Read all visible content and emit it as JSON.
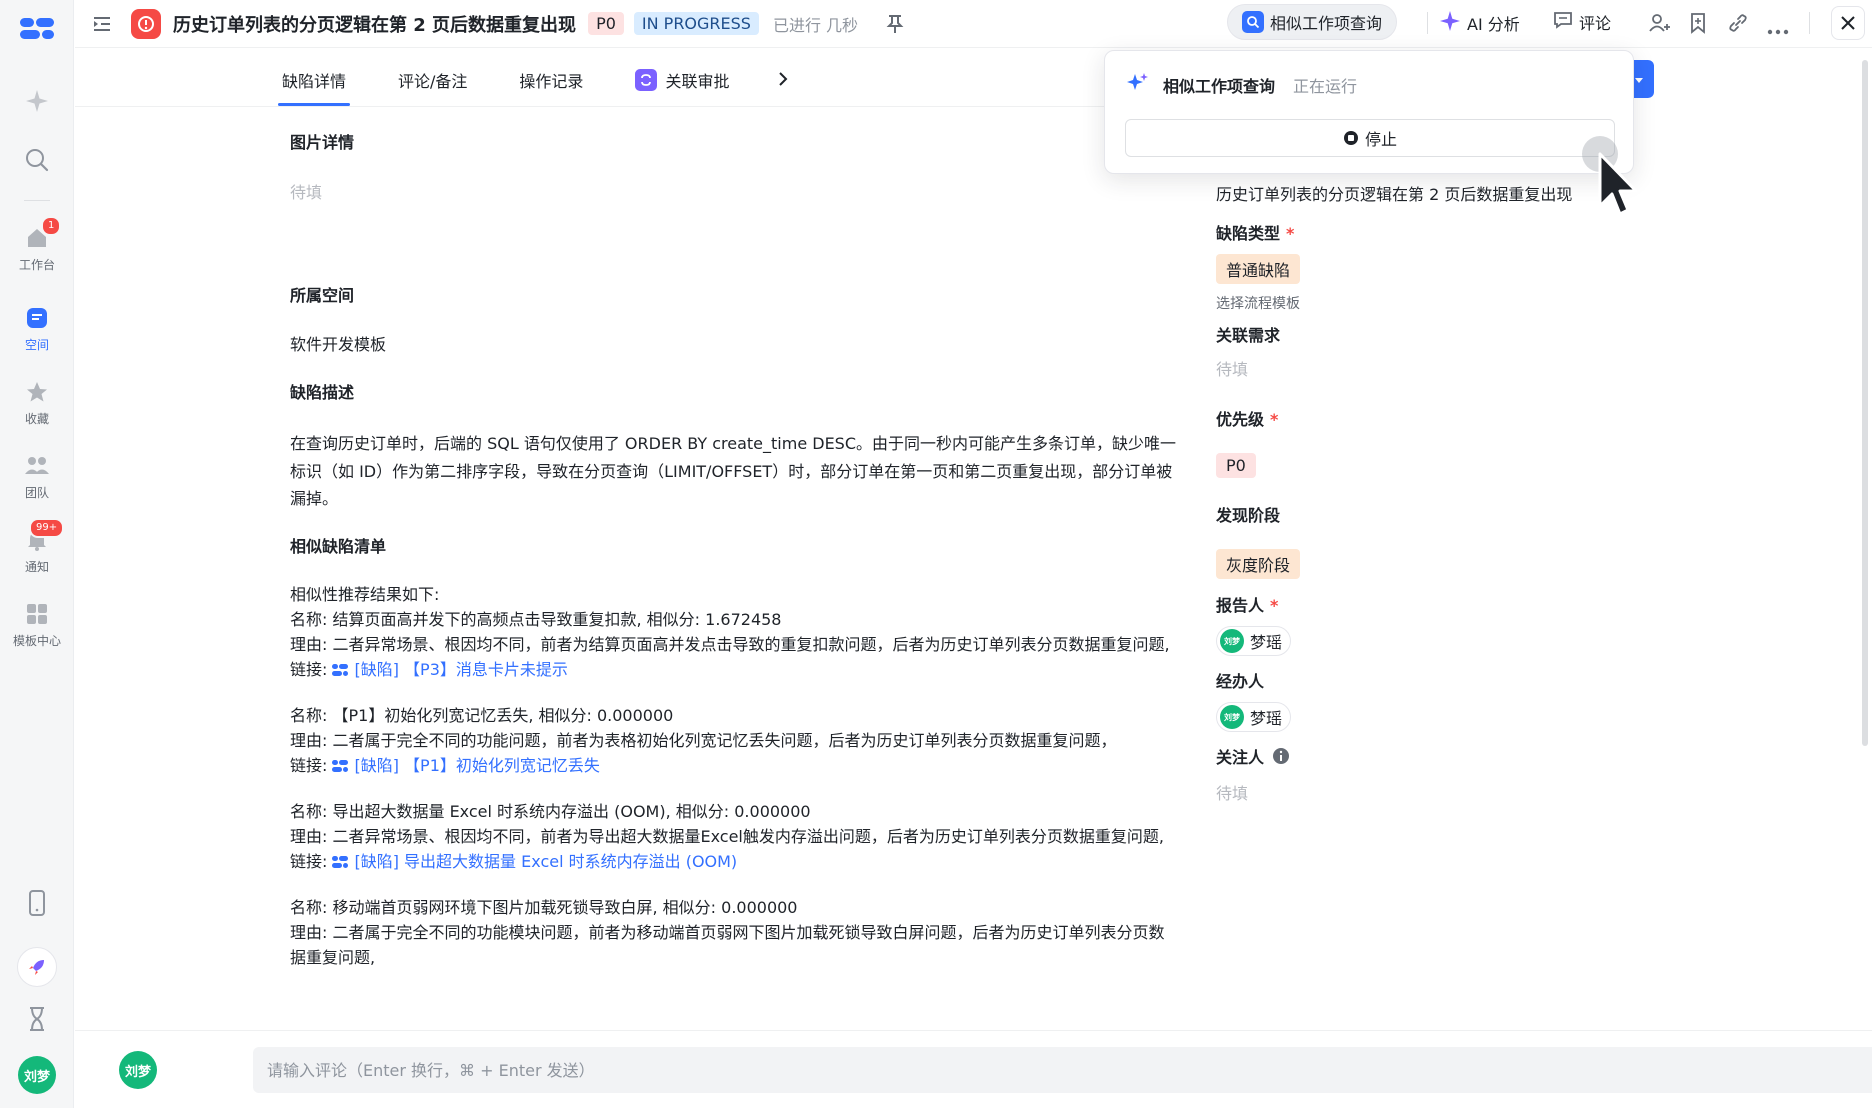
{
  "rail": {
    "items": [
      {
        "label": "工作台",
        "badge": "1",
        "icon": "home-icon"
      },
      {
        "label": "空间",
        "badge": "",
        "icon": "space-icon"
      },
      {
        "label": "收藏",
        "badge": "",
        "icon": "star-icon"
      },
      {
        "label": "团队",
        "badge": "",
        "icon": "team-icon"
      },
      {
        "label": "通知",
        "badge": "99+",
        "icon": "bell-icon"
      },
      {
        "label": "模板中心",
        "badge": "",
        "icon": "grid-icon"
      }
    ],
    "user_avatar": "刘梦"
  },
  "header": {
    "title": "历史订单列表的分页逻辑在第 2 页后数据重复出现",
    "priority": "P0",
    "status": "IN PROGRESS",
    "elapsed": "已进行 几秒",
    "similar_query_label": "相似工作项查询",
    "ai_label": "AI 分析",
    "comment_label": "评论"
  },
  "tabs": [
    {
      "label": "缺陷详情",
      "active": true
    },
    {
      "label": "评论/备注",
      "active": false
    },
    {
      "label": "操作记录",
      "active": false
    },
    {
      "label": "关联审批",
      "active": false
    }
  ],
  "main": {
    "image_title": "图片详情",
    "image_placeholder": "待填",
    "space_title": "所属空间",
    "space_value": "软件开发模板",
    "desc_title": "缺陷描述",
    "desc_text": "在查询历史订单时，后端的 SQL 语句仅使用了 ORDER BY create_time DESC。由于同一秒内可能产生多条订单，缺少唯一标识（如 ID）作为第二排序字段，导致在分页查询（LIMIT/OFFSET）时，部分订单在第一页和第二页重复出现，部分订单被漏掉。",
    "similar_title": "相似缺陷清单",
    "similar_intro": "相似性推荐结果如下:",
    "name_prefix": "名称: ",
    "reason_prefix": "理由: ",
    "link_prefix": "链接: ",
    "items": [
      {
        "name": "结算页面高并发下的高频点击导致重复扣款, 相似分: 1.672458",
        "reason": "二者异常场景、根因均不同，前者为结算页面高并发点击导致的重复扣款问题，后者为历史订单列表分页数据重复问题,",
        "link": "[缺陷] 【P3】消息卡片未提示"
      },
      {
        "name": "【P1】初始化列宽记忆丢失, 相似分: 0.000000",
        "reason": "二者属于完全不同的功能问题，前者为表格初始化列宽记忆丢失问题，后者为历史订单列表分页数据重复问题，",
        "link": "[缺陷] 【P1】初始化列宽记忆丢失"
      },
      {
        "name": "导出超大数据量 Excel 时系统内存溢出 (OOM), 相似分: 0.000000",
        "reason": "二者异常场景、根因均不同，前者为导出超大数据量Excel触发内存溢出问题，后者为历史订单列表分页数据重复问题,",
        "link": "[缺陷] 导出超大数据量 Excel 时系统内存溢出 (OOM)"
      },
      {
        "name": "移动端首页弱网环境下图片加载死锁导致白屏, 相似分: 0.000000",
        "reason": "二者属于完全不同的功能模块问题，前者为移动端首页弱网下图片加载死锁导致白屏问题，后者为历史订单列表分页数据重复问题,",
        "link": ""
      }
    ]
  },
  "right": {
    "title_value": "历史订单列表的分页逻辑在第 2 页后数据重复出现",
    "defect_type_label": "缺陷类型",
    "defect_type_value": "普通缺陷",
    "flow_template_hint": "选择流程模板",
    "related_req_label": "关联需求",
    "related_req_value": "待填",
    "priority_label": "优先级",
    "priority_value": "P0",
    "phase_label": "发现阶段",
    "phase_value": "灰度阶段",
    "reporter_label": "报告人",
    "reporter_value": "梦瑶",
    "assignee_label": "经办人",
    "assignee_value": "梦瑶",
    "watcher_label": "关注人",
    "watcher_value": "待填",
    "avatar_text": "刘梦"
  },
  "popover": {
    "title": "相似工作项查询",
    "status": "正在运行",
    "stop_label": "停止"
  },
  "comment": {
    "avatar": "刘梦",
    "placeholder": "请输入评论（Enter 换行，⌘ + Enter 发送）"
  },
  "colors": {
    "accent": "#3370ff",
    "danger": "#f54a45",
    "purple": "#7b61ff"
  }
}
